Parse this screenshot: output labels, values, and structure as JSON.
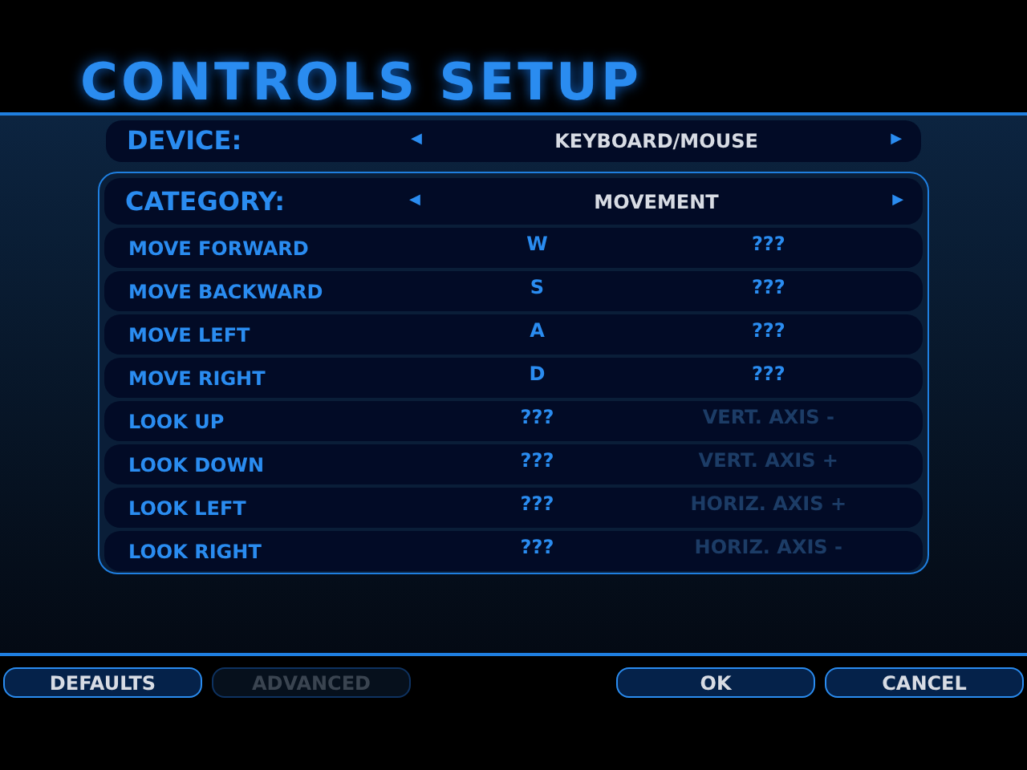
{
  "title": "CONTROLS SETUP",
  "device": {
    "label": "DEVICE:",
    "value": "KEYBOARD/MOUSE",
    "prev": "◀",
    "next": "▶"
  },
  "category": {
    "label": "CATEGORY:",
    "value": "MOVEMENT",
    "prev": "◀",
    "next": "▶"
  },
  "bindings": [
    {
      "action": "MOVE FORWARD",
      "primary": "W",
      "secondary": "???",
      "disabled": false
    },
    {
      "action": "MOVE BACKWARD",
      "primary": "S",
      "secondary": "???",
      "disabled": false
    },
    {
      "action": "MOVE LEFT",
      "primary": "A",
      "secondary": "???",
      "disabled": false
    },
    {
      "action": "MOVE RIGHT",
      "primary": "D",
      "secondary": "???",
      "disabled": false
    },
    {
      "action": "LOOK UP",
      "primary": "???",
      "secondary": "VERT. AXIS -",
      "disabled": true
    },
    {
      "action": "LOOK DOWN",
      "primary": "???",
      "secondary": "VERT. AXIS +",
      "disabled": true
    },
    {
      "action": "LOOK LEFT",
      "primary": "???",
      "secondary": "HORIZ. AXIS +",
      "disabled": true
    },
    {
      "action": "LOOK RIGHT",
      "primary": "???",
      "secondary": "HORIZ. AXIS -",
      "disabled": true
    }
  ],
  "buttons_left": [
    {
      "label": "DEFAULTS",
      "disabled": false
    },
    {
      "label": "ADVANCED",
      "disabled": true
    }
  ],
  "buttons_right": [
    {
      "label": "OK",
      "disabled": false
    },
    {
      "label": "CANCEL",
      "disabled": false
    }
  ]
}
